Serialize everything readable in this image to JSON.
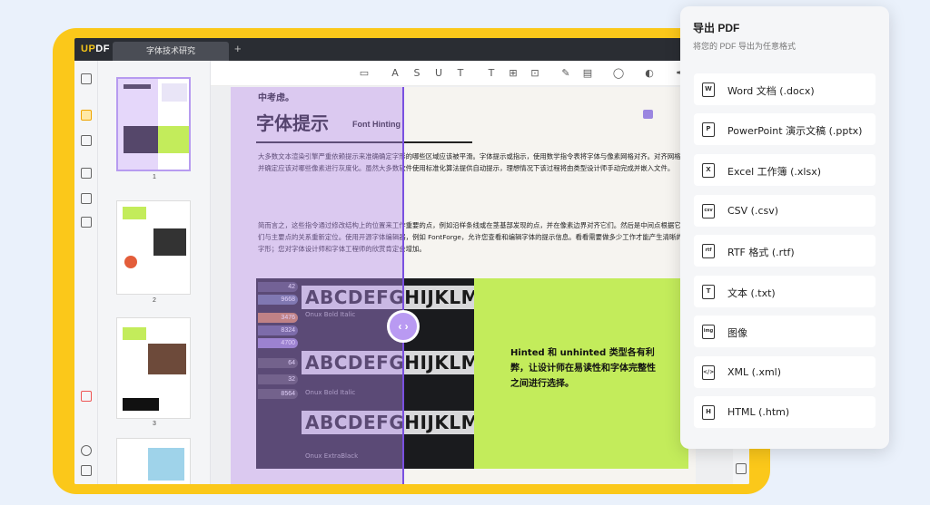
{
  "app": {
    "logo_prefix": "UP",
    "logo_suffix": "DF",
    "tab_label": "字体技术研究",
    "new_tab_symbol": "+"
  },
  "thumbnails": [
    {
      "num": "1"
    },
    {
      "num": "2"
    },
    {
      "num": "3"
    }
  ],
  "document": {
    "top_text": "中考虑。",
    "title": "字体提示",
    "subtitle": "Font Hinting",
    "paragraph1": "大多数文本渲染引擎严重依赖提示来准确确定字形的哪些区域应该被平滑。字体提示或指示，使用数学指令表将字体与像素网格对齐。对齐网格并确定应该对哪些像素进行灰度化。虽然大多数软件使用标准化算法提供自动提示，理想情况下该过程将由类型设计师手动完成并嵌入文件。",
    "paragraph2": "简而言之，这些指令通过修改结构上的位置来工作重要的点，例如沿样条线或在茎基部发现的点，并在像素边界对齐它们。然后是中间点根据它们与主要点的关系重新定位。使用开源字体编辑器，例如 FontForge，允许您查看和编辑字体的提示信息。看看需要做多少工作才能产生清晰的字形；您对字体设计师和字体工程师的欣赏肯定会增加。",
    "photo_numbers": [
      "42",
      "9668",
      "3476",
      "8324",
      "4700",
      "64",
      "32",
      "8564"
    ],
    "photo_line": "ABCDEFGHIJKLMNO",
    "photo_caption": "Onux Bold Italic",
    "photo_caption2": "Onux ExtraBlack",
    "lime_text": "Hinted 和 unhinted 类型各有利弊，让设计师在易读性和字体完整性之间进行选择。"
  },
  "export_panel": {
    "title": "导出 PDF",
    "subtitle": "将您的 PDF 导出为任意格式",
    "options": [
      {
        "label": "Word 文档 (.docx)",
        "icon": "W"
      },
      {
        "label": "PowerPoint 演示文稿 (.pptx)",
        "icon": "P"
      },
      {
        "label": "Excel 工作簿 (.xlsx)",
        "icon": "X"
      },
      {
        "label": "CSV (.csv)",
        "icon": "csv"
      },
      {
        "label": "RTF 格式 (.rtf)",
        "icon": "rtf"
      },
      {
        "label": "文本 (.txt)",
        "icon": "T"
      },
      {
        "label": "图像",
        "icon": "img"
      },
      {
        "label": "XML (.xml)",
        "icon": "</>"
      },
      {
        "label": "HTML (.htm)",
        "icon": "H"
      }
    ]
  },
  "colors": {
    "frame": "#fbc81a",
    "accent": "#7a50e0",
    "lime": "#c3ec5b"
  }
}
